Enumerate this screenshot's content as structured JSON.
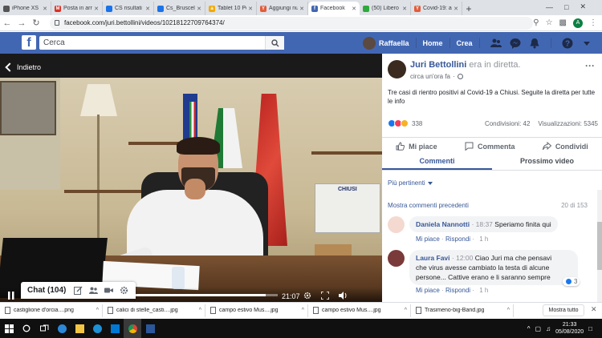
{
  "browser": {
    "tabs": [
      {
        "title": "iPhone XS",
        "color": "#555"
      },
      {
        "title": "Posta in arr",
        "color": "#d93025",
        "glyph": "M"
      },
      {
        "title": "CS risultati",
        "color": "#1a73e8"
      },
      {
        "title": "Cs_Brusceli",
        "color": "#1a73e8"
      },
      {
        "title": "Tablet 10 Pc",
        "color": "#f2a900",
        "glyph": "a"
      },
      {
        "title": "Aggiungi nu",
        "color": "#e25c3b",
        "glyph": "Y"
      },
      {
        "title": "Facebook",
        "color": "#4267b2",
        "glyph": "f",
        "active": true
      },
      {
        "title": "(50) Libero",
        "color": "#2eaa3c"
      },
      {
        "title": "Covid-19: a",
        "color": "#e25c3b",
        "glyph": "Y"
      }
    ],
    "new_tab": "+",
    "url": "facebook.com/juri.bettollini/videos/10218122709764374/",
    "profile_initial": "A"
  },
  "fb_header": {
    "logo": "f",
    "search_placeholder": "Cerca",
    "user_name": "Raffaella",
    "nav_home": "Home",
    "nav_create": "Crea"
  },
  "video": {
    "back_label": "Indietro",
    "time": "21:07",
    "progress": 0.95,
    "board_text": "CHIUSI"
  },
  "chat": {
    "label": "Chat (104)"
  },
  "post": {
    "author": "Juri Bettollini",
    "status": "era in diretta.",
    "time": "circa un'ora fa",
    "text": "Tre casi di rientro positivi al Covid-19 a Chiusi. Seguite la diretta per tutte le info",
    "reactions_count": "338",
    "shares": "Condivisioni: 42",
    "views": "Visualizzazioni: 5345",
    "actions": {
      "like": "Mi piace",
      "comment": "Commenta",
      "share": "Condividi"
    },
    "tabs": {
      "comments": "Commenti",
      "next_video": "Prossimo video"
    },
    "filter": "Più pertinenti",
    "show_more": "Mostra commenti precedenti",
    "comment_count": "20 di 153",
    "comments": [
      {
        "name": "Daniela Nannotti",
        "time": "18:37",
        "text": "Speriamo finita qui",
        "like": "Mi piace",
        "reply": "Rispondi",
        "age": "1 h"
      },
      {
        "name": "Laura Favi",
        "time": "12:00",
        "text_l1": "Ciao Juri ma che pensavi",
        "text_l2": "che virus avesse cambiato la testa di alcune",
        "text_l3": "persone... Cattive erano e li saranno sempre",
        "likes": "3",
        "like": "Mi piace",
        "reply": "Rispondi",
        "age": "1 h"
      }
    ]
  },
  "downloads": {
    "items": [
      "castiglione d'orcia....png",
      "calici di stelle_casti....jpg",
      "campo estivo Mus....jpg",
      "campo estivo Mus....jpg",
      "Trasimeno-big-Band.jpg"
    ],
    "show_all": "Mostra tutto"
  },
  "taskbar": {
    "time": "21:33",
    "date": "05/08/2020"
  }
}
